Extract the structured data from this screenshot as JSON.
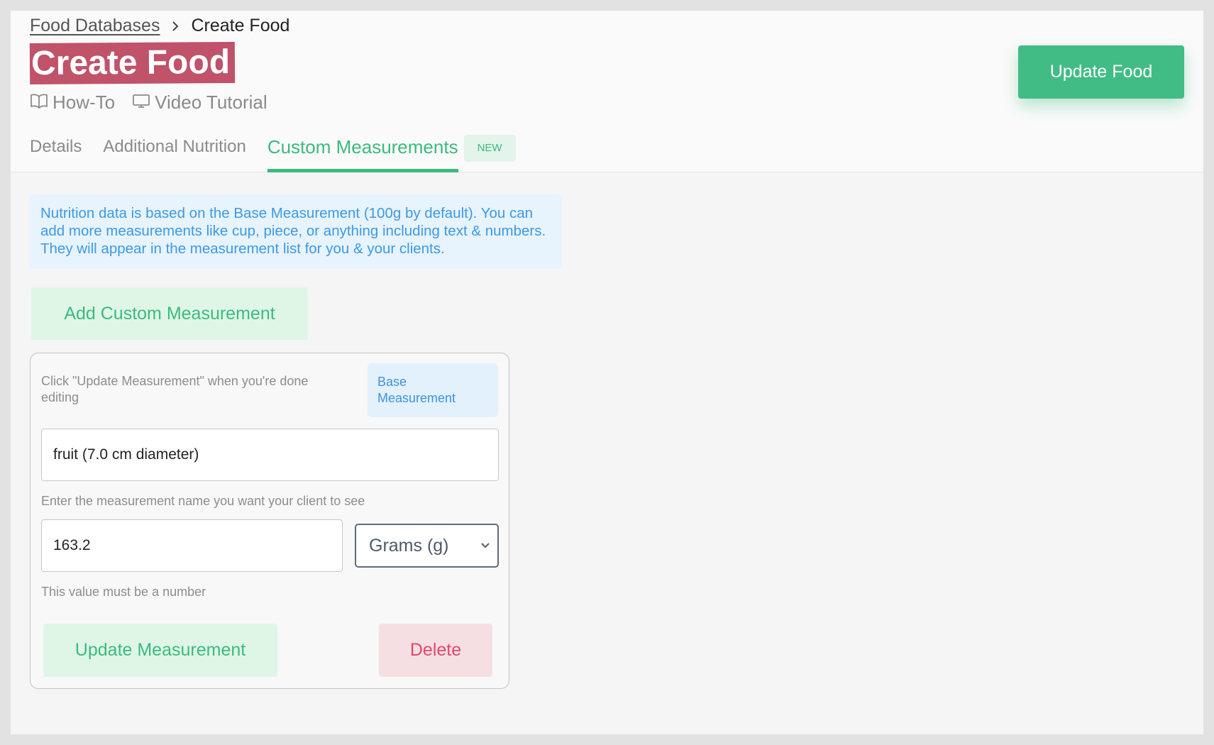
{
  "colors": {
    "accent_green": "#3cba7f",
    "title_highlight": "#c0526a",
    "info_blue": "#3c9ae6",
    "danger": "#e0486e"
  },
  "breadcrumb": {
    "parent": "Food Databases",
    "current": "Create Food",
    "separator_icon": "chevron-right-icon"
  },
  "page": {
    "title": "Create Food"
  },
  "help_links": [
    {
      "label": "How-To",
      "icon": "book-open-icon"
    },
    {
      "label": "Video Tutorial",
      "icon": "monitor-icon"
    }
  ],
  "tabs": [
    {
      "label": "Details",
      "active": false
    },
    {
      "label": "Additional Nutrition",
      "active": false
    },
    {
      "label": "Custom Measurements",
      "active": true,
      "badge": "NEW"
    }
  ],
  "header_actions": {
    "update_food": "Update Food"
  },
  "info": {
    "text": "Nutrition data is based on the Base Measurement (100g by default). You can add more measurements like cup, piece, or anything including text & numbers. They will appear in the measurement list for you & your clients."
  },
  "actions": {
    "add_custom_measurement": "Add Custom Measurement"
  },
  "measurement_card": {
    "hint": "Click \"Update Measurement\" when you're done editing",
    "base_badge": "Base Measurement",
    "name_value": "fruit (7.0 cm diameter)",
    "name_help": "Enter the measurement name you want your client to see",
    "quantity_value": "163.2",
    "unit_selected": "Grams (g)",
    "quantity_help": "This value must be a number",
    "update_button": "Update Measurement",
    "delete_button": "Delete"
  }
}
